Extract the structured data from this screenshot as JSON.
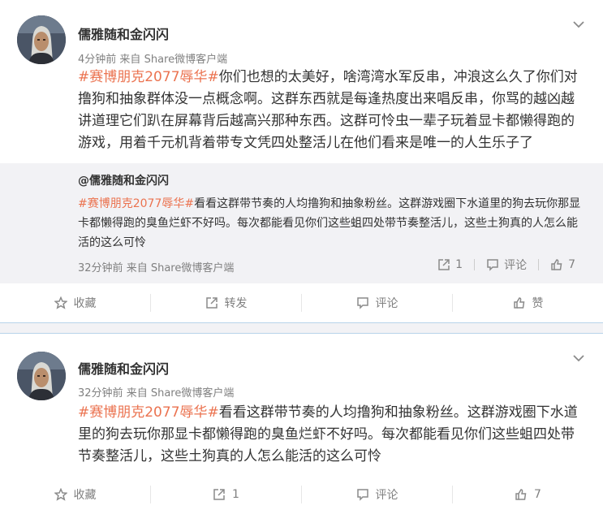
{
  "post1": {
    "user": "儒雅随和金闪闪",
    "time": "4分钟前",
    "source_prefix": "来自",
    "source": "Share微博客户端",
    "hashtag": "#赛博朋克2077辱华#",
    "text": "你们也想的太美好，啥湾湾水军反串，冲浪这么久了你们对撸狗和抽象群体没一点概念啊。这群东西就是每逢热度出来唱反串，你骂的越凶越讲道理它们趴在屏幕背后越高兴那种东西。这群可怜虫一辈子玩着显卡都懒得跑的游戏，用着千元机背着带专文凭四处整活儿在他们看来是唯一的人生乐子了",
    "repost": {
      "user": "@儒雅随和金闪闪",
      "hashtag": "#赛博朋克2077辱华#",
      "text": "看看这群带节奏的人均撸狗和抽象粉丝。这群游戏圈下水道里的狗去玩你那显卡都懒得跑的臭鱼烂虾不好吗。每次都能看见你们这些蛆四处带节奏整活儿，这些土狗真的人怎么能活的这么可怜",
      "time": "32分钟前",
      "source_prefix": "来自",
      "source": "Share微博客户端",
      "share_count": "1",
      "comment_label": "评论",
      "like_count": "7"
    },
    "actions": {
      "collect": "收藏",
      "forward": "转发",
      "comment": "评论",
      "like": "赞"
    }
  },
  "post2": {
    "user": "儒雅随和金闪闪",
    "time": "32分钟前",
    "source_prefix": "来自",
    "source": "Share微博客户端",
    "hashtag": "#赛博朋克2077辱华#",
    "text": "看看这群带节奏的人均撸狗和抽象粉丝。这群游戏圈下水道里的狗去玩你那显卡都懒得跑的臭鱼烂虾不好吗。每次都能看见你们这些蛆四处带节奏整活儿，这些土狗真的人怎么能活的这么可怜",
    "actions": {
      "collect": "收藏",
      "forward": "1",
      "comment": "评论",
      "like": "7"
    }
  },
  "colors": {
    "hashtag": "#eb7350",
    "repost_bg": "#f2f2f5",
    "meta": "#808080"
  }
}
